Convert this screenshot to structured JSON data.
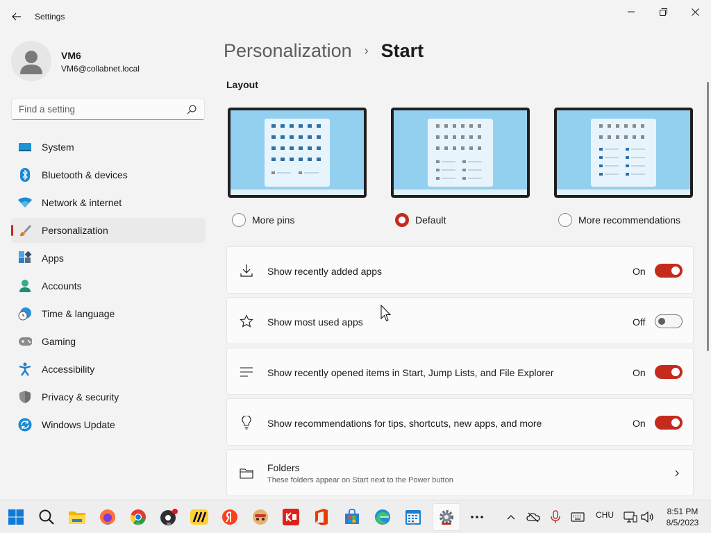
{
  "window": {
    "title": "Settings"
  },
  "user": {
    "name": "VM6",
    "email": "VM6@collabnet.local"
  },
  "search": {
    "placeholder": "Find a setting"
  },
  "nav": {
    "items": [
      {
        "label": "System",
        "icon": "system-icon"
      },
      {
        "label": "Bluetooth & devices",
        "icon": "bluetooth-icon"
      },
      {
        "label": "Network & internet",
        "icon": "wifi-icon"
      },
      {
        "label": "Personalization",
        "icon": "brush-icon",
        "active": true
      },
      {
        "label": "Apps",
        "icon": "apps-icon"
      },
      {
        "label": "Accounts",
        "icon": "accounts-icon"
      },
      {
        "label": "Time & language",
        "icon": "globe-clock-icon"
      },
      {
        "label": "Gaming",
        "icon": "gamepad-icon"
      },
      {
        "label": "Accessibility",
        "icon": "accessibility-icon"
      },
      {
        "label": "Privacy & security",
        "icon": "shield-icon"
      },
      {
        "label": "Windows Update",
        "icon": "update-icon"
      }
    ]
  },
  "breadcrumb": {
    "parent": "Personalization",
    "separator": "›",
    "current": "Start"
  },
  "layout": {
    "title": "Layout",
    "options": [
      {
        "label": "More pins",
        "selected": false
      },
      {
        "label": "Default",
        "selected": true
      },
      {
        "label": "More recommendations",
        "selected": false
      }
    ]
  },
  "settings": [
    {
      "label": "Show recently added apps",
      "state": "On",
      "icon": "download-icon"
    },
    {
      "label": "Show most used apps",
      "state": "Off",
      "icon": "star-icon"
    },
    {
      "label": "Show recently opened items in Start, Jump Lists, and File Explorer",
      "state": "On",
      "icon": "list-icon"
    },
    {
      "label": "Show recommendations for tips, shortcuts, new apps, and more",
      "state": "On",
      "icon": "lightbulb-icon"
    }
  ],
  "folders": {
    "title": "Folders",
    "subtitle": "These folders appear on Start next to the Power button"
  },
  "taskbar": {
    "language": "CHU",
    "time": "8:51 PM",
    "date": "8/5/2023"
  },
  "colors": {
    "accent": "#c42b1c",
    "background": "#f3f3f3",
    "card": "#fbfbfb"
  }
}
